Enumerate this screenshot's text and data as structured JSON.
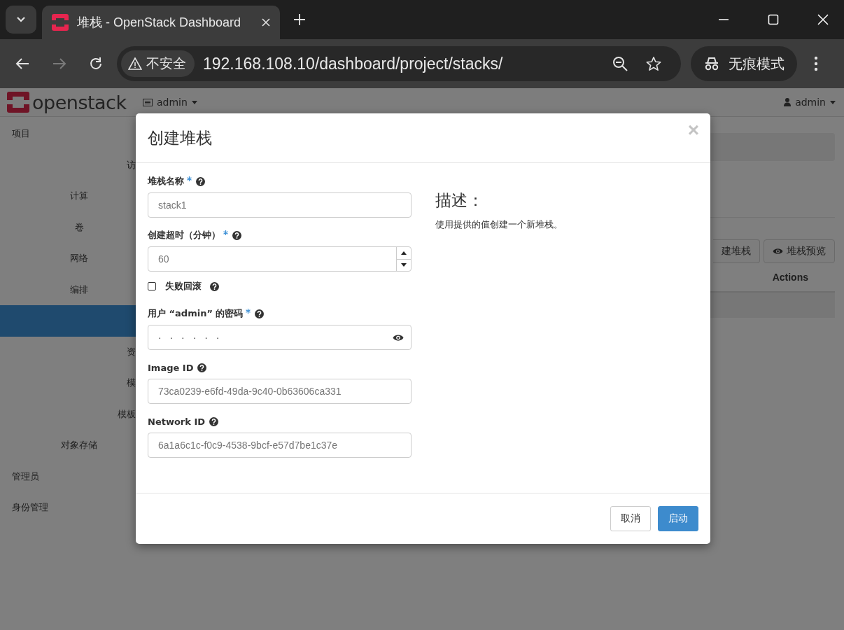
{
  "browser": {
    "tab_title": "堆栈 - OpenStack Dashboard",
    "security": "不安全",
    "url": "192.168.108.10/dashboard/project/stacks/",
    "profile": "无痕模式"
  },
  "topbar": {
    "logo": "openstack",
    "project": "admin",
    "user": "admin"
  },
  "sidebar": [
    {
      "label": "项目",
      "children": [
        {
          "label": "访",
          "cut": true
        },
        {
          "label": "计算"
        },
        {
          "label": "卷"
        },
        {
          "label": "网络"
        },
        {
          "label": "编排",
          "children": [
            {
              "selected": true
            },
            {
              "label": "资",
              "cut": true,
              "selected": false
            },
            {
              "label": "模",
              "cut": true,
              "selected": false
            },
            {
              "label": "模板",
              "cut": true,
              "selected": false
            }
          ]
        },
        {
          "label": "对象存储"
        }
      ]
    },
    {
      "label": "管理员"
    },
    {
      "label": "身份管理"
    }
  ],
  "content": {
    "buttons": [
      {
        "label": "建堆栈",
        "kind": "cut"
      },
      {
        "label": "堆栈预览",
        "kind": "preview"
      }
    ],
    "table": {
      "columns": [
        "Actions"
      ]
    }
  },
  "modal": {
    "title": "创建堆栈",
    "close": "×",
    "fields": [
      {
        "kind": "text",
        "label": "堆栈名称",
        "required": true,
        "help": true,
        "value": "stack1"
      },
      {
        "kind": "number",
        "label": "创建超时（分钟）",
        "required": true,
        "help": true,
        "value": "60"
      },
      {
        "kind": "checkbox",
        "label": "失败回滚",
        "help": true,
        "checked": false
      },
      {
        "kind": "password",
        "label": "用户 “admin” 的密码",
        "required": true,
        "help": true,
        "value": "· · · · · ·"
      },
      {
        "kind": "text",
        "label": "Image ID",
        "required": false,
        "help": true,
        "value": "73ca0239-e6fd-49da-9c40-0b63606ca331"
      },
      {
        "kind": "text",
        "label": "Network ID",
        "required": false,
        "help": true,
        "value": "6a1a6c1c-f0c9-4538-9bcf-e57d7be1c37e"
      }
    ],
    "description": {
      "heading": "描述：",
      "text": "使用提供的值创建一个新堆栈。"
    },
    "buttons": [
      {
        "label": "取消",
        "kind": "default"
      },
      {
        "label": "启动",
        "kind": "primary"
      }
    ]
  }
}
